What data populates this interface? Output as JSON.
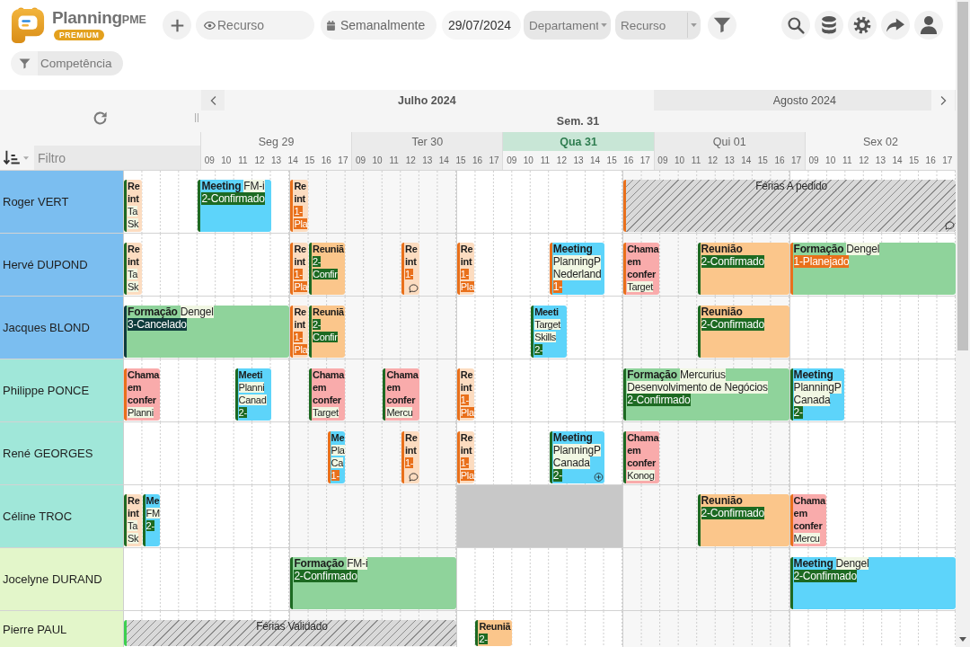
{
  "brand": {
    "name": "Planning",
    "suffix": "PME",
    "badge": "PREMIUM"
  },
  "toolbar": {
    "resource_search": {
      "placeholder": "Recurso"
    },
    "view": {
      "value": "Semanalmente"
    },
    "date": {
      "value": "29/07/2024"
    },
    "department": {
      "placeholder": "Departament"
    },
    "resource": {
      "placeholder": "Recurso"
    },
    "skill_filter": {
      "placeholder": "Competência"
    }
  },
  "calendar": {
    "filter": {
      "placeholder": "Filtro"
    },
    "week": "Sem. 31",
    "months": [
      {
        "label": "Julho 2024",
        "current": true,
        "days": [
          {
            "label": "Seg 29",
            "today": false,
            "hours": [
              "09",
              "10",
              "11",
              "12",
              "13",
              "14",
              "15",
              "16",
              "17"
            ]
          },
          {
            "label": "Ter 30",
            "today": false,
            "hours": [
              "09",
              "10",
              "11",
              "12",
              "13",
              "14",
              "15",
              "16",
              "17"
            ]
          },
          {
            "label": "Qua 31",
            "today": true,
            "hours": [
              "09",
              "10",
              "11",
              "12",
              "13",
              "14",
              "15",
              "16",
              "17"
            ]
          }
        ]
      },
      {
        "label": "Agosto 2024",
        "current": false,
        "days": [
          {
            "label": "Qui 01",
            "today": false,
            "hours": [
              "09",
              "10",
              "11",
              "12",
              "13",
              "14",
              "15",
              "16",
              "17"
            ]
          },
          {
            "label": "Sex 02",
            "today": false,
            "hours": [
              "09",
              "10",
              "11",
              "12",
              "13",
              "14",
              "15",
              "16",
              "17"
            ]
          }
        ]
      }
    ]
  },
  "resources": [
    {
      "name": "Roger VERT",
      "color": "#7bbef0",
      "events": [
        {
          "kind": "task",
          "color": "#fcdcc0",
          "confirmed": true,
          "cancelled": false,
          "commented": false,
          "expandable": false,
          "lines": [
            {
              "title": "Re"
            },
            {
              "title": "int"
            },
            {
              "detail": "Ta"
            },
            {
              "detail": "Sk"
            }
          ]
        },
        {
          "kind": "task",
          "color": "#5dd4fa",
          "confirmed": true,
          "cancelled": false,
          "commented": false,
          "expandable": false,
          "lines": [
            {
              "title": "Meeting",
              "detail": "FM-i"
            },
            {
              "status": "2-Confirmado"
            }
          ]
        },
        {
          "kind": "task",
          "color": "#fcdcc0",
          "confirmed": false,
          "cancelled": false,
          "commented": false,
          "expandable": false,
          "lines": [
            {
              "title": "Re"
            },
            {
              "title": "int"
            },
            {
              "status": "1-"
            },
            {
              "status": "Pla"
            }
          ]
        },
        {
          "kind": "absence",
          "color": "#d9d9d9",
          "confirmed": false,
          "commented": true,
          "expandable": false,
          "lines": [
            {
              "title": "Férias A pedido"
            }
          ]
        }
      ]
    },
    {
      "name": "Hervé DUPOND",
      "color": "#7bbef0",
      "events": [
        {
          "kind": "task",
          "color": "#fcdcc0",
          "confirmed": true,
          "cancelled": false,
          "commented": false,
          "expandable": false,
          "lines": [
            {
              "title": "Re"
            },
            {
              "title": "int"
            },
            {
              "detail": "Ta"
            },
            {
              "detail": "Sk"
            }
          ]
        },
        {
          "kind": "task",
          "color": "#fcdcc0",
          "confirmed": false,
          "cancelled": false,
          "commented": false,
          "expandable": false,
          "lines": [
            {
              "title": "Re"
            },
            {
              "title": "int"
            },
            {
              "status": "1-"
            },
            {
              "status": "Pla"
            }
          ]
        },
        {
          "kind": "task",
          "color": "#fbc68b",
          "confirmed": true,
          "cancelled": false,
          "commented": false,
          "expandable": false,
          "lines": [
            {
              "title": "Reuniã"
            },
            {
              "status": "2-"
            },
            {
              "status": "Confir"
            }
          ]
        },
        {
          "kind": "task",
          "color": "#fcdcc0",
          "confirmed": false,
          "cancelled": false,
          "commented": true,
          "expandable": false,
          "lines": [
            {
              "title": "Re"
            },
            {
              "title": "int"
            },
            {
              "status": "1-"
            }
          ]
        },
        {
          "kind": "task",
          "color": "#fcdcc0",
          "confirmed": false,
          "cancelled": false,
          "commented": false,
          "expandable": false,
          "lines": [
            {
              "title": "Re"
            },
            {
              "title": "int"
            },
            {
              "status": "1-"
            },
            {
              "status": "Pla"
            }
          ]
        },
        {
          "kind": "task",
          "color": "#5dd4fa",
          "confirmed": false,
          "cancelled": false,
          "commented": false,
          "expandable": false,
          "lines": [
            {
              "title": "Meeting"
            },
            {
              "detail": "PlanningP"
            },
            {
              "detail": "Nederland"
            },
            {
              "status": "1-"
            }
          ]
        },
        {
          "kind": "task",
          "color": "#f9abab",
          "confirmed": false,
          "cancelled": false,
          "commented": false,
          "expandable": false,
          "lines": [
            {
              "title": "Chama"
            },
            {
              "title": "em"
            },
            {
              "title": "confer"
            },
            {
              "detail": "Target"
            }
          ]
        },
        {
          "kind": "task",
          "color": "#fbc68b",
          "confirmed": true,
          "cancelled": false,
          "commented": false,
          "expandable": false,
          "lines": [
            {
              "title": "Reunião"
            },
            {
              "status": "2-Confirmado"
            }
          ]
        },
        {
          "kind": "task",
          "color": "#8fd39b",
          "confirmed": false,
          "cancelled": false,
          "commented": false,
          "expandable": false,
          "lines": [
            {
              "title": "Formação",
              "detail": "Dengel"
            },
            {
              "status": "1-Planejado"
            }
          ]
        }
      ]
    },
    {
      "name": "Jacques BLOND",
      "color": "#7bbef0",
      "events": [
        {
          "kind": "task",
          "color": "#8fd39b",
          "confirmed": false,
          "cancelled": true,
          "commented": false,
          "expandable": false,
          "lines": [
            {
              "title": "Formação",
              "detail": "Dengel"
            },
            {
              "status": "3-Cancelado"
            }
          ]
        },
        {
          "kind": "task",
          "color": "#fcdcc0",
          "confirmed": false,
          "cancelled": false,
          "commented": false,
          "expandable": false,
          "lines": [
            {
              "title": "Re"
            },
            {
              "title": "int"
            },
            {
              "status": "1-"
            },
            {
              "status": "Pla"
            }
          ]
        },
        {
          "kind": "task",
          "color": "#fbc68b",
          "confirmed": true,
          "cancelled": false,
          "commented": false,
          "expandable": false,
          "lines": [
            {
              "title": "Reuniã"
            },
            {
              "status": "2-"
            },
            {
              "status": "Confir"
            }
          ]
        },
        {
          "kind": "task",
          "color": "#5dd4fa",
          "confirmed": true,
          "cancelled": false,
          "commented": false,
          "expandable": false,
          "lines": [
            {
              "title": "Meeti"
            },
            {
              "detail": "Target"
            },
            {
              "detail": "Skills"
            },
            {
              "status": "2-"
            }
          ]
        },
        {
          "kind": "task",
          "color": "#fbc68b",
          "confirmed": true,
          "cancelled": false,
          "commented": false,
          "expandable": false,
          "lines": [
            {
              "title": "Reunião"
            },
            {
              "status": "2-Confirmado"
            }
          ]
        }
      ]
    },
    {
      "name": "Philippe PONCE",
      "color": "#a0e7d9",
      "events": [
        {
          "kind": "task",
          "color": "#f9abab",
          "confirmed": false,
          "cancelled": false,
          "commented": false,
          "expandable": false,
          "lines": [
            {
              "title": "Chama"
            },
            {
              "title": "em"
            },
            {
              "title": "confer"
            },
            {
              "detail": "Planni"
            }
          ]
        },
        {
          "kind": "task",
          "color": "#5dd4fa",
          "confirmed": true,
          "cancelled": false,
          "commented": false,
          "expandable": false,
          "lines": [
            {
              "title": "Meeti"
            },
            {
              "detail": "Planni"
            },
            {
              "detail": "Canad"
            },
            {
              "status": "2-"
            }
          ]
        },
        {
          "kind": "task",
          "color": "#f9abab",
          "confirmed": true,
          "cancelled": false,
          "commented": false,
          "expandable": false,
          "lines": [
            {
              "title": "Chama"
            },
            {
              "title": "em"
            },
            {
              "title": "confer"
            },
            {
              "detail": "Target"
            }
          ]
        },
        {
          "kind": "task",
          "color": "#f9abab",
          "confirmed": true,
          "cancelled": false,
          "commented": false,
          "expandable": false,
          "lines": [
            {
              "title": "Chama"
            },
            {
              "title": "em"
            },
            {
              "title": "confer"
            },
            {
              "detail": "Mercu"
            }
          ]
        },
        {
          "kind": "task",
          "color": "#fcdcc0",
          "confirmed": false,
          "cancelled": false,
          "commented": false,
          "expandable": false,
          "lines": [
            {
              "title": "Re"
            },
            {
              "title": "int"
            },
            {
              "status": "1-"
            },
            {
              "status": "Pla"
            }
          ]
        },
        {
          "kind": "task",
          "color": "#8fd39b",
          "confirmed": true,
          "cancelled": false,
          "commented": false,
          "expandable": false,
          "lines": [
            {
              "title": "Formação",
              "detail": "Mercurius"
            },
            {
              "detail": "Desenvolvimento de Negócios"
            },
            {
              "status": "2-Confirmado"
            }
          ]
        },
        {
          "kind": "task",
          "color": "#5dd4fa",
          "confirmed": true,
          "cancelled": false,
          "commented": false,
          "expandable": false,
          "lines": [
            {
              "title": "Meeting"
            },
            {
              "detail": "PlanningP"
            },
            {
              "detail": "Canada"
            },
            {
              "status": "2-"
            }
          ]
        }
      ]
    },
    {
      "name": "René GEORGES",
      "color": "#a0e7d9",
      "events": [
        {
          "kind": "task",
          "color": "#5dd4fa",
          "confirmed": false,
          "cancelled": false,
          "commented": false,
          "expandable": false,
          "lines": [
            {
              "title": "Me"
            },
            {
              "detail": "Pla"
            },
            {
              "detail": "Ca"
            },
            {
              "status": "1-"
            }
          ]
        },
        {
          "kind": "task",
          "color": "#fcdcc0",
          "confirmed": false,
          "cancelled": false,
          "commented": true,
          "expandable": false,
          "lines": [
            {
              "title": "Re"
            },
            {
              "title": "int"
            },
            {
              "status": "1-"
            }
          ]
        },
        {
          "kind": "task",
          "color": "#fcdcc0",
          "confirmed": false,
          "cancelled": false,
          "commented": false,
          "expandable": false,
          "lines": [
            {
              "title": "Re"
            },
            {
              "title": "int"
            },
            {
              "status": "1-"
            },
            {
              "status": "Pla"
            }
          ]
        },
        {
          "kind": "task",
          "color": "#5dd4fa",
          "confirmed": true,
          "cancelled": false,
          "commented": false,
          "expandable": true,
          "lines": [
            {
              "title": "Meeting"
            },
            {
              "detail": "PlanningP"
            },
            {
              "detail": "Canada"
            },
            {
              "status": "2-"
            }
          ]
        },
        {
          "kind": "task",
          "color": "#f9abab",
          "confirmed": true,
          "cancelled": false,
          "commented": false,
          "expandable": false,
          "lines": [
            {
              "title": "Chama"
            },
            {
              "title": "em"
            },
            {
              "title": "confer"
            },
            {
              "detail": "Konog"
            }
          ]
        }
      ]
    },
    {
      "name": "Céline TROC",
      "color": "#a0e7d9",
      "events": [
        {
          "kind": "task",
          "color": "#fcdcc0",
          "confirmed": true,
          "cancelled": false,
          "commented": false,
          "expandable": false,
          "lines": [
            {
              "title": "Re"
            },
            {
              "title": "int"
            },
            {
              "detail": "Ta"
            },
            {
              "detail": "Sk"
            }
          ]
        },
        {
          "kind": "task",
          "color": "#5dd4fa",
          "confirmed": true,
          "cancelled": false,
          "commented": false,
          "expandable": false,
          "lines": [
            {
              "title": "Me"
            },
            {
              "detail": "FM"
            },
            {
              "status": "2-"
            }
          ]
        },
        {
          "kind": "blocked",
          "color": "#c8c8c8",
          "commented": false,
          "expandable": false
        },
        {
          "kind": "task",
          "color": "#fbc68b",
          "confirmed": true,
          "cancelled": false,
          "commented": false,
          "expandable": false,
          "lines": [
            {
              "title": "Reunião"
            },
            {
              "status": "2-Confirmado"
            }
          ]
        },
        {
          "kind": "task",
          "color": "#f9abab",
          "confirmed": false,
          "cancelled": false,
          "commented": false,
          "expandable": false,
          "lines": [
            {
              "title": "Chama"
            },
            {
              "title": "em"
            },
            {
              "title": "confer"
            },
            {
              "detail": "Mercu"
            }
          ]
        }
      ]
    },
    {
      "name": "Jocelyne DURAND",
      "color": "#e3f6ca",
      "events": [
        {
          "kind": "task",
          "color": "#8fd39b",
          "confirmed": true,
          "cancelled": false,
          "commented": false,
          "expandable": false,
          "lines": [
            {
              "title": "Formação",
              "detail": "FM-i"
            },
            {
              "status": "2-Confirmado"
            }
          ]
        },
        {
          "kind": "task",
          "color": "#5dd4fa",
          "confirmed": true,
          "cancelled": false,
          "commented": false,
          "expandable": false,
          "lines": [
            {
              "title": "Meeting",
              "detail": "Dengel"
            },
            {
              "status": "2-Confirmado"
            }
          ]
        }
      ]
    },
    {
      "name": "Pierre PAUL",
      "color": "#e3f6ca",
      "events": [
        {
          "kind": "absence",
          "color": "#d9d9d9",
          "confirmed": true,
          "commented": false,
          "expandable": false,
          "lines": [
            {
              "title": "Férias Validado"
            }
          ]
        },
        {
          "kind": "task",
          "color": "#fbc68b",
          "confirmed": true,
          "cancelled": false,
          "commented": false,
          "expandable": false,
          "lines": [
            {
              "title": "Reuniã"
            },
            {
              "status": "2-"
            }
          ]
        }
      ]
    }
  ]
}
